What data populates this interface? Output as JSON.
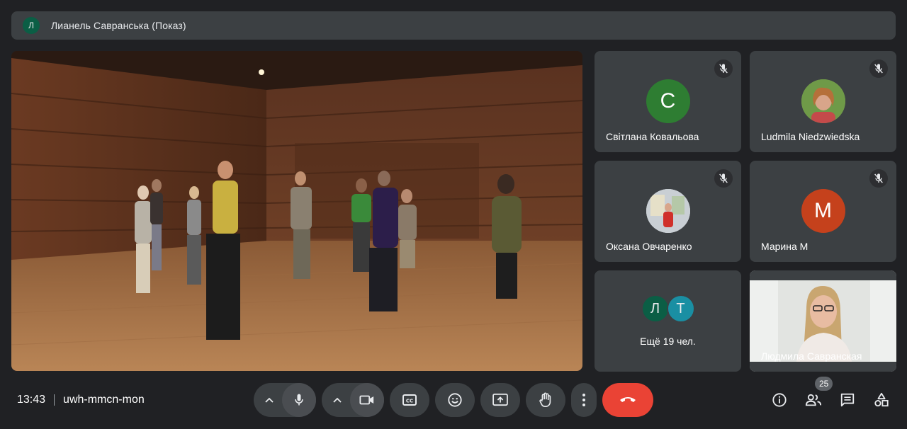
{
  "presenter": {
    "initial": "Л",
    "name": "Лианель Савранська (Показ)"
  },
  "participants": [
    {
      "name": "Світлана Ковальова",
      "initial": "С",
      "color": "#2e7d32",
      "muted": true,
      "type": "initial"
    },
    {
      "name": "Ludmila Niedzwiedska",
      "muted": true,
      "type": "photo"
    },
    {
      "name": "Оксана Овчаренко",
      "muted": true,
      "type": "photo"
    },
    {
      "name": "Марина М",
      "initial": "М",
      "color": "#c5411c",
      "muted": true,
      "type": "initial"
    }
  ],
  "more": {
    "initials": [
      "Л",
      "Т"
    ],
    "colors": [
      "#0b5e45",
      "#1a8fa3"
    ],
    "label": "Ещё 19 чел."
  },
  "self": {
    "name": "Людмила Савранская"
  },
  "meeting": {
    "time": "13:43",
    "code": "uwh-mmcn-mon"
  },
  "participant_count": "25",
  "colors": {
    "background": "#202124",
    "tile": "#3c4043",
    "end_call": "#ea4335"
  },
  "icons": [
    "chevron-up-icon",
    "mic-icon",
    "camera-icon",
    "captions-icon",
    "emoji-icon",
    "present-icon",
    "hand-icon",
    "more-vert-icon",
    "end-call-icon",
    "info-icon",
    "people-icon",
    "chat-icon",
    "activities-icon",
    "mic-off-icon"
  ]
}
